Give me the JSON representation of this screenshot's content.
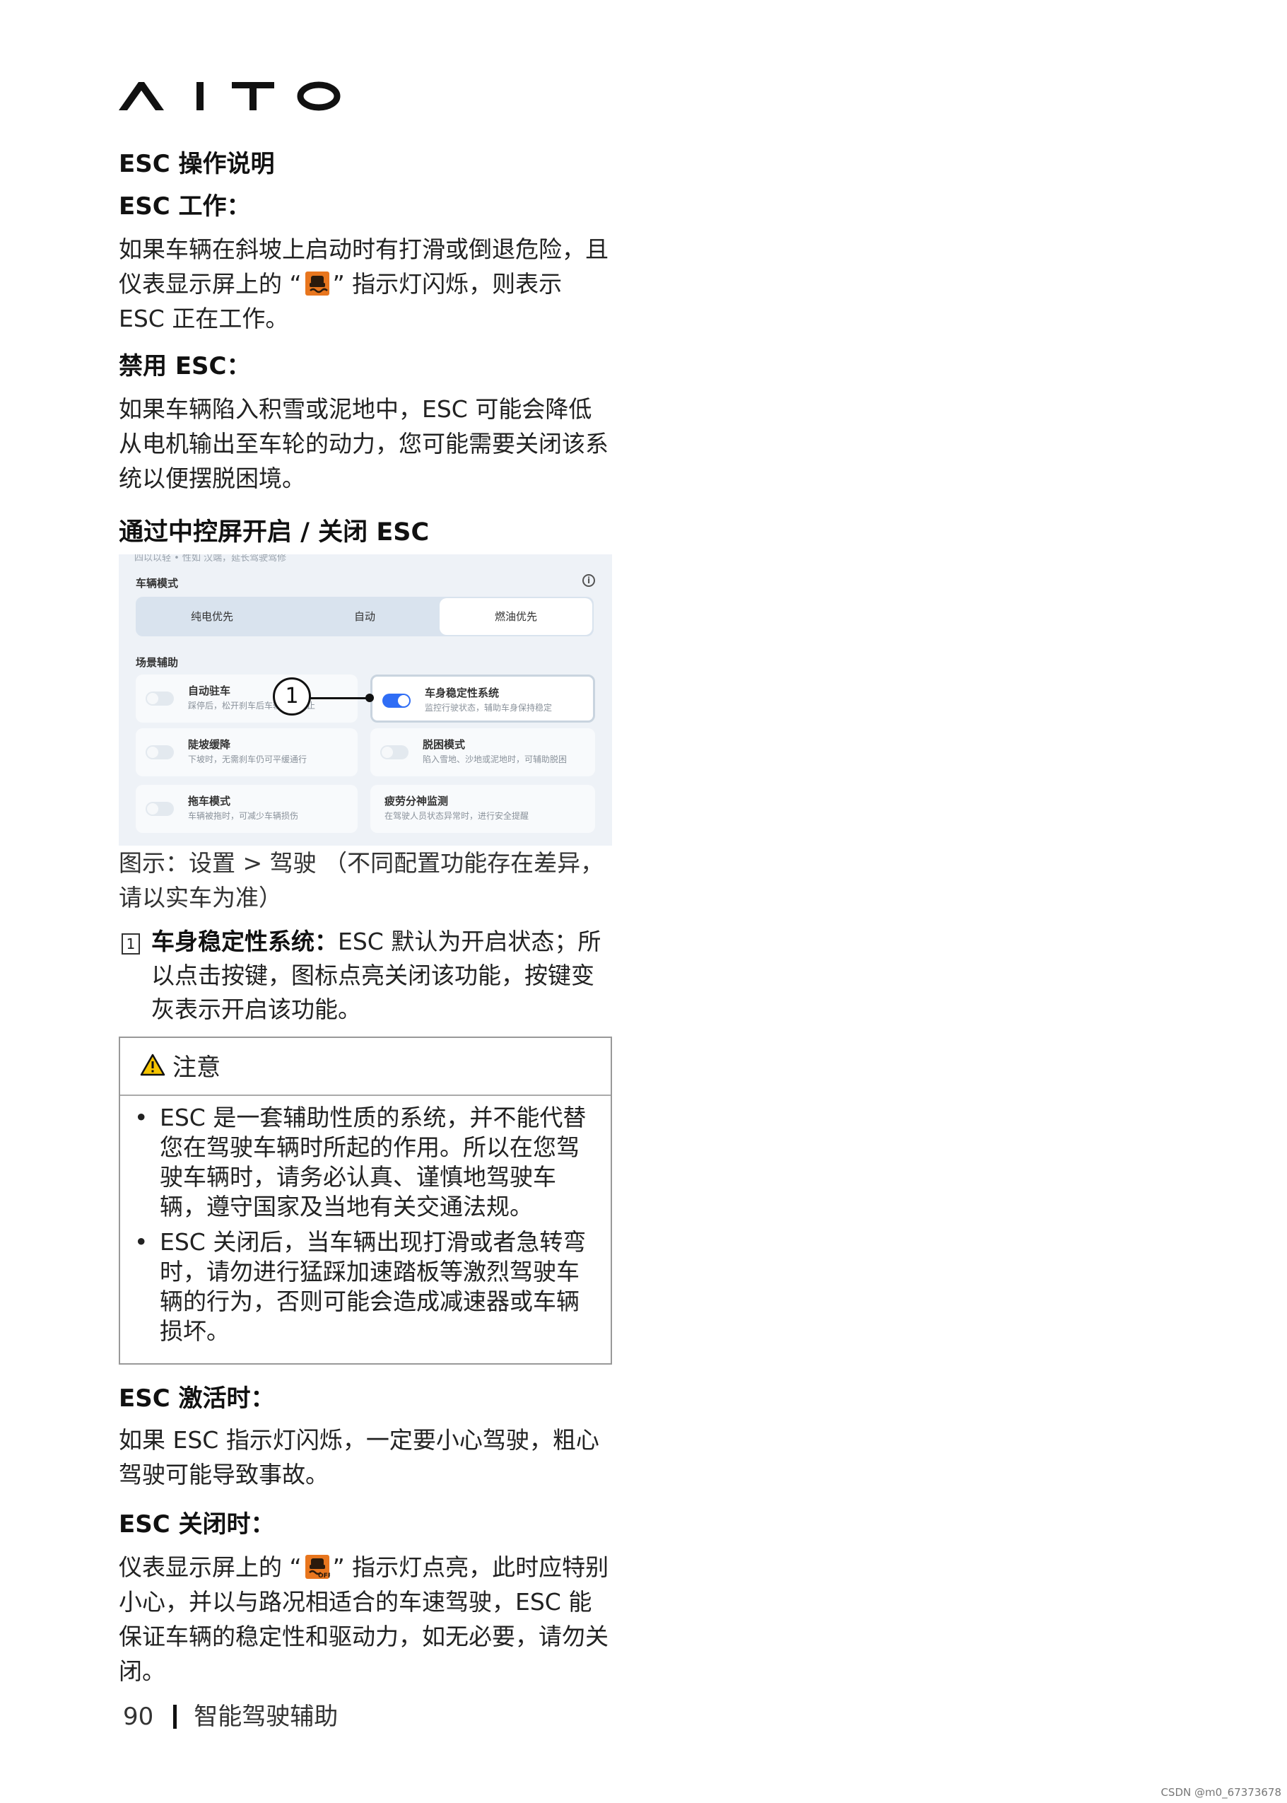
{
  "brand": {
    "logo": "AITO"
  },
  "section": {
    "title": "ESC 操作说明",
    "esc_working_heading": "ESC 工作：",
    "esc_working_text_1": "如果车辆在斜坡上启动时有打滑或倒退危险，且仪表显示屏上的 “",
    "esc_working_text_2": "” 指示灯闪烁，则表示 ESC 正在工作。",
    "disable_heading": "禁用 ESC：",
    "disable_text": "如果车辆陷入积雪或泥地中，ESC 可能会降低从电机输出至车轮的动力，您可能需要关闭该系统以便摆脱困境。",
    "control_heading": "通过中控屏开启 / 关闭 ESC"
  },
  "screenshot": {
    "cut_text": "四以以轻 • 性如 汉端，延长驾驶驾修",
    "mode_title": "车辆模式",
    "info_icon_glyph": "i",
    "modes": [
      "纯电优先",
      "自动",
      "燃油优先"
    ],
    "scene_title": "场景辅助",
    "callout_number": "1",
    "cards": [
      {
        "title": "自动驻车",
        "desc": "踩停后，松开刹车后车辆保持静止",
        "on": false
      },
      {
        "title": "车身稳定性系统",
        "desc": "监控行驶状态，辅助车身保持稳定",
        "on": true
      },
      {
        "title": "陡坡缓降",
        "desc": "下坡时，无需刹车仍可平缓通行",
        "on": false
      },
      {
        "title": "脱困模式",
        "desc": "陷入雪地、沙地或泥地时，可辅助脱困",
        "on": false
      },
      {
        "title": "拖车模式",
        "desc": "车辆被拖时，可减少车辆损伤",
        "on": false
      },
      {
        "title": "疲劳分神监测",
        "desc": "在驾驶人员状态异常时，进行安全提醒",
        "on": false
      }
    ]
  },
  "caption": "图示：设置 > 驾驶 （不同配置功能存在差异，请以实车为准）",
  "item1": {
    "number": "1",
    "bold": "车身稳定性系统：",
    "text": "ESC 默认为开启状态；所以点击按键，图标点亮关闭该功能，按键变灰表示开启该功能。"
  },
  "notice": {
    "title": "注意",
    "bullets": [
      "ESC 是一套辅助性质的系统，并不能代替您在驾驶车辆时所起的作用。所以在您驾驶车辆时，请务必认真、谨慎地驾驶车辆，遵守国家及当地有关交通法规。",
      "ESC 关闭后，当车辆出现打滑或者急转弯时，请勿进行猛踩加速踏板等激烈驾驶车辆的行为，否则可能会造成减速器或车辆损坏。"
    ]
  },
  "esc_active": {
    "heading": "ESC 激活时：",
    "text": "如果 ESC 指示灯闪烁，一定要小心驾驶，粗心驾驶可能导致事故。"
  },
  "esc_off": {
    "heading": "ESC 关闭时：",
    "text_1": "仪表显示屏上的 “",
    "text_2": "” 指示灯点亮，此时应特别小心，并以与路况相适合的车速驾驶，ESC 能保证车辆的稳定性和驱动力，如无必要，请勿关闭。"
  },
  "footer": {
    "page_number": "90",
    "chapter": "智能驾驶辅助"
  },
  "watermark": "CSDN @m0_67373678",
  "colors": {
    "esc_icon": "#e8761e",
    "toggle_on": "#2f6df5"
  }
}
